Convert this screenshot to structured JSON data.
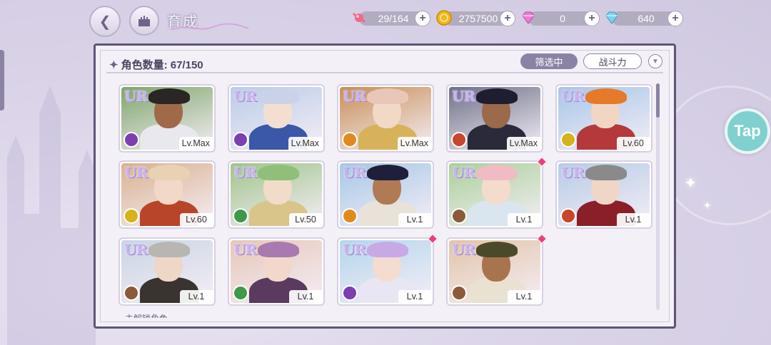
{
  "header": {
    "title": "育成",
    "resources": [
      {
        "name": "candy",
        "value": "29/164",
        "icon": "candy-icon",
        "color": "#f06a8a"
      },
      {
        "name": "gold",
        "value": "2757500",
        "icon": "coin-icon",
        "color": "#f3b51a"
      },
      {
        "name": "pink-gem",
        "value": "0",
        "icon": "pink-diamond-icon",
        "color": "#f07bd7"
      },
      {
        "name": "blue-gem",
        "value": "640",
        "icon": "blue-diamond-icon",
        "color": "#7ad3f0"
      }
    ],
    "plus_symbol": "+"
  },
  "panel": {
    "count_label": "角色数量:",
    "count_value": "67/150",
    "filter_label": "筛选中",
    "sort_label": "战斗力",
    "more_label": "未解锁角色"
  },
  "cards": [
    {
      "rarity": "UR",
      "level": "Lv.Max",
      "element": "purple",
      "hair": "#2a2624",
      "skin": "#a06a48",
      "outfit": "#e8e8ee",
      "bg": "#7fa56a",
      "new": false
    },
    {
      "rarity": "UR",
      "level": "Lv.Max",
      "element": "purple",
      "hair": "#c9d2e6",
      "skin": "#f3dfd2",
      "outfit": "#3a57a8",
      "bg": "#b9cce8",
      "new": false
    },
    {
      "rarity": "UR",
      "level": "Lv.Max",
      "element": "orange",
      "hair": "#e9c7b8",
      "skin": "#f2d9c6",
      "outfit": "#d7b25a",
      "bg": "#c98e58",
      "new": false
    },
    {
      "rarity": "UR",
      "level": "Lv.Max",
      "element": "red",
      "hair": "#1f1e30",
      "skin": "#9a6a4a",
      "outfit": "#2a2a3a",
      "bg": "#6d7088",
      "new": false
    },
    {
      "rarity": "UR",
      "level": "Lv.60",
      "element": "yellow",
      "hair": "#e57b2a",
      "skin": "#f2d6c4",
      "outfit": "#b5383a",
      "bg": "#a7c6e8",
      "new": false
    },
    {
      "rarity": "UR",
      "level": "Lv.60",
      "element": "yellow",
      "hair": "#e8d2b2",
      "skin": "#f2d8c6",
      "outfit": "#b8442a",
      "bg": "#d9b18f",
      "new": false
    },
    {
      "rarity": "UR",
      "level": "Lv.50",
      "element": "green",
      "hair": "#8fbf78",
      "skin": "#f0dcc8",
      "outfit": "#d9c48a",
      "bg": "#9fc48b",
      "new": false
    },
    {
      "rarity": "UR",
      "level": "Lv.1",
      "element": "orange",
      "hair": "#1e1f3a",
      "skin": "#b07a55",
      "outfit": "#e8e2d8",
      "bg": "#a6c7e6",
      "new": false
    },
    {
      "rarity": "UR",
      "level": "Lv.1",
      "element": "brown",
      "hair": "#efbcc4",
      "skin": "#f4dccd",
      "outfit": "#d9e6f0",
      "bg": "#a9d09a",
      "new": true
    },
    {
      "rarity": "UR",
      "level": "Lv.1",
      "element": "red",
      "hair": "#8a8a8a",
      "skin": "#f0d6c6",
      "outfit": "#8a1f28",
      "bg": "#b6cbe6",
      "new": false
    },
    {
      "rarity": "UR",
      "level": "Lv.1",
      "element": "brown",
      "hair": "#b7b6b2",
      "skin": "#efd7c8",
      "outfit": "#3a3330",
      "bg": "#c9d4e4",
      "new": false
    },
    {
      "rarity": "UR",
      "level": "Lv.1",
      "element": "green",
      "hair": "#a87ab0",
      "skin": "#f2d8ca",
      "outfit": "#5a3a5e",
      "bg": "#e6c7b8",
      "new": false
    },
    {
      "rarity": "UR",
      "level": "Lv.1",
      "element": "purple",
      "hair": "#c7a9e6",
      "skin": "#f4dcd0",
      "outfit": "#e8e6f2",
      "bg": "#b3d6ec",
      "new": true
    },
    {
      "rarity": "UR",
      "level": "Lv.1",
      "element": "brown",
      "hair": "#4a4a2a",
      "skin": "#a8744e",
      "outfit": "#e9e2d2",
      "bg": "#e2c3a8",
      "new": true
    }
  ],
  "overlay": {
    "tap_label": "Tap"
  }
}
